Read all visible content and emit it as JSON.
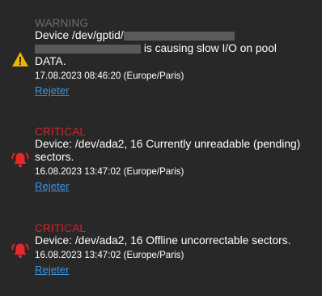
{
  "alerts": [
    {
      "level": "WARNING",
      "level_color": "#6e6e6e",
      "icon": "warning-triangle-icon",
      "message_line1": "Device /dev/gptid/",
      "message_line2": "is causing slow I/O on pool",
      "message_line3": "DATA.",
      "timestamp": "17.08.2023 08:46:20 (Europe/Paris)",
      "dismiss_label": "Rejeter"
    },
    {
      "level": "CRITICAL",
      "level_color": "#d2232a",
      "icon": "bell-alert-icon",
      "message": "Device: /dev/ada2, 16 Currently unreadable (pending) sectors.",
      "timestamp": "16.08.2023 13:47:02 (Europe/Paris)",
      "dismiss_label": "Rejeter"
    },
    {
      "level": "CRITICAL",
      "level_color": "#d2232a",
      "icon": "bell-alert-icon",
      "message": "Device: /dev/ada2, 16 Offline uncorrectable sectors.",
      "timestamp": "16.08.2023 13:47:02 (Europe/Paris)",
      "dismiss_label": "Rejeter"
    }
  ],
  "colors": {
    "background": "#282828",
    "link": "#3d93de",
    "warning_icon": "#f0b400",
    "critical_icon": "#e8262c"
  }
}
